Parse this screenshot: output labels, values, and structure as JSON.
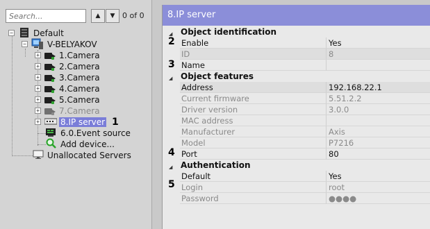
{
  "search": {
    "placeholder": "Search...",
    "counter": "0 of 0"
  },
  "tree": {
    "root": "Default",
    "server": "V-BELYAKOV",
    "cameras": [
      "1.Camera",
      "2.Camera",
      "3.Camera",
      "4.Camera",
      "5.Camera",
      "7.Camera"
    ],
    "ip_server": "8.IP server",
    "event_source": "6.0.Event source",
    "add_device": "Add device...",
    "unallocated": "Unallocated Servers"
  },
  "markers": [
    "1",
    "2",
    "3",
    "4",
    "5"
  ],
  "panel": {
    "title": "8.IP server",
    "categories": [
      "Object identification",
      "Object features",
      "Authentication"
    ],
    "identification": [
      {
        "name": "Enable",
        "value": "Yes"
      },
      {
        "name": "ID",
        "value": "8"
      },
      {
        "name": "Name",
        "value": ""
      }
    ],
    "features": [
      {
        "name": "Address",
        "value": "192.168.22.1"
      },
      {
        "name": "Current firmware",
        "value": "5.51.2.2"
      },
      {
        "name": "Driver version",
        "value": "3.0.0"
      },
      {
        "name": "MAC address",
        "value": ""
      },
      {
        "name": "Manufacturer",
        "value": "Axis"
      },
      {
        "name": "Model",
        "value": "P7216"
      },
      {
        "name": "Port",
        "value": "80"
      }
    ],
    "authentication": [
      {
        "name": "Default",
        "value": "Yes"
      },
      {
        "name": "Login",
        "value": "root"
      },
      {
        "name": "Password",
        "value": "●●●●"
      }
    ]
  },
  "colors": {
    "title_bar": "#8b8ed9",
    "selection": "#7a7dd8",
    "camera_led": "#2fa22f"
  }
}
